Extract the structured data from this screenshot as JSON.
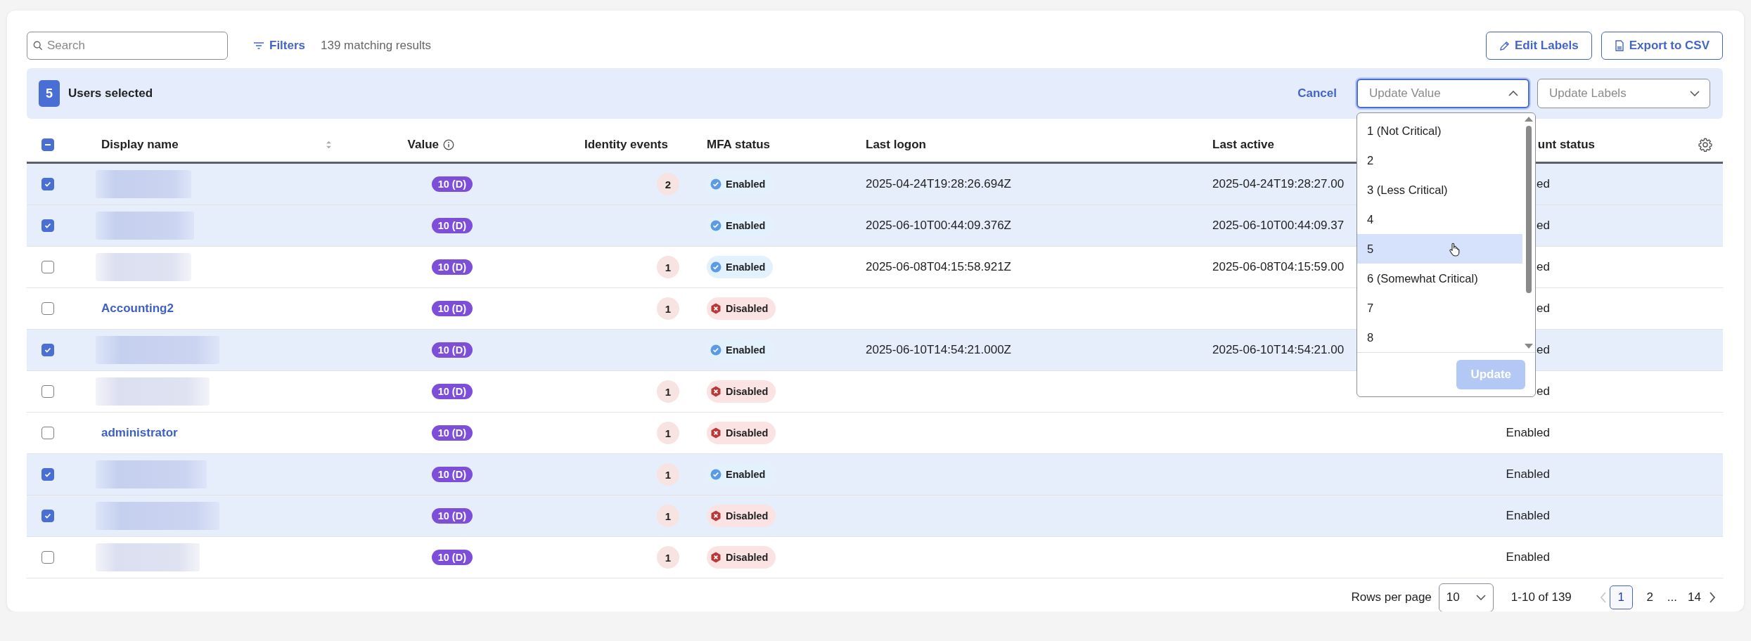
{
  "toolbar": {
    "search": {
      "placeholder": "Search"
    },
    "filters_button": "Filters",
    "result_count": "139 matching results",
    "buttons": [
      {
        "label": "Edit Labels",
        "kind": "edit"
      },
      {
        "label": "Export to CSV",
        "kind": "export"
      }
    ]
  },
  "selection_bar": {
    "count": "5",
    "label": "Users selected",
    "cancel": "Cancel",
    "update_value": {
      "placeholder": "Update Value",
      "open": true,
      "options": [
        {
          "label": "1 (Not Critical)",
          "selected": false
        },
        {
          "label": "2",
          "selected": false
        },
        {
          "label": "3 (Less Critical)",
          "selected": false
        },
        {
          "label": "4",
          "selected": false
        },
        {
          "label": "5",
          "selected": true
        },
        {
          "label": "6 (Somewhat Critical)",
          "selected": false
        },
        {
          "label": "7",
          "selected": false
        },
        {
          "label": "8",
          "selected": false
        }
      ],
      "apply_button": {
        "label": "Update",
        "disabled": true
      }
    },
    "update_labels": {
      "placeholder": "Update Labels",
      "open": false
    }
  },
  "table": {
    "select_all_partial": true,
    "columns": [
      "Display name",
      "Value",
      "Identity events",
      "MFA status",
      "Last logon",
      "Last active",
      "unt status"
    ],
    "rows": [
      {
        "checked": true,
        "name_redacted": true,
        "value": "10 (D)",
        "identity_events": "2",
        "mfa": {
          "kind": "enabled",
          "label": "Enabled"
        },
        "last_logon": "2025-04-24T19:28:26.694Z",
        "last_active": "2025-04-24T19:28:27.00",
        "account_status": "ed"
      },
      {
        "checked": true,
        "name_redacted": true,
        "value": "10 (D)",
        "mfa": {
          "kind": "enabled",
          "label": "Enabled"
        },
        "last_logon": "2025-06-10T00:44:09.376Z",
        "last_active": "2025-06-10T00:44:09.37",
        "account_status": "ed"
      },
      {
        "checked": false,
        "name_redacted": true,
        "value": "10 (D)",
        "identity_events": "1",
        "mfa": {
          "kind": "enabled",
          "label": "Enabled"
        },
        "last_logon": "2025-06-08T04:15:58.921Z",
        "last_active": "2025-06-08T04:15:59.00",
        "account_status": "ed"
      },
      {
        "checked": false,
        "name_redacted": false,
        "name": "Accounting2",
        "value": "10 (D)",
        "identity_events": "1",
        "mfa": {
          "kind": "disabled",
          "label": "Disabled"
        },
        "account_status": "ed"
      },
      {
        "checked": true,
        "name_redacted": true,
        "value": "10 (D)",
        "mfa": {
          "kind": "enabled",
          "label": "Enabled"
        },
        "last_logon": "2025-06-10T14:54:21.000Z",
        "last_active": "2025-06-10T14:54:21.00",
        "account_status": "ed"
      },
      {
        "checked": false,
        "name_redacted": true,
        "value": "10 (D)",
        "identity_events": "1",
        "mfa": {
          "kind": "disabled",
          "label": "Disabled"
        },
        "account_status": "ed"
      },
      {
        "checked": false,
        "name_redacted": false,
        "name": "administrator",
        "value": "10 (D)",
        "identity_events": "1",
        "mfa": {
          "kind": "disabled",
          "label": "Disabled"
        },
        "account_status": "Enabled"
      },
      {
        "checked": true,
        "name_redacted": true,
        "value": "10 (D)",
        "identity_events": "1",
        "mfa": {
          "kind": "enabled",
          "label": "Enabled"
        },
        "account_status": "Enabled"
      },
      {
        "checked": true,
        "name_redacted": true,
        "value": "10 (D)",
        "identity_events": "1",
        "mfa": {
          "kind": "disabled",
          "label": "Disabled"
        },
        "account_status": "Enabled"
      },
      {
        "checked": false,
        "name_redacted": true,
        "value": "10 (D)",
        "identity_events": "1",
        "mfa": {
          "kind": "disabled",
          "label": "Disabled"
        },
        "account_status": "Enabled"
      }
    ]
  },
  "pagination": {
    "rows_per_page_label": "Rows per page",
    "rows_per_page": "10",
    "range": "1-10 of 139",
    "prev_disabled": true,
    "pages": [
      {
        "kind": "page",
        "label": "1",
        "selected": true
      },
      {
        "kind": "page",
        "label": "2",
        "selected": false
      },
      {
        "kind": "gap",
        "label": "...",
        "selected": false
      },
      {
        "kind": "page",
        "label": "14",
        "selected": false
      }
    ]
  }
}
